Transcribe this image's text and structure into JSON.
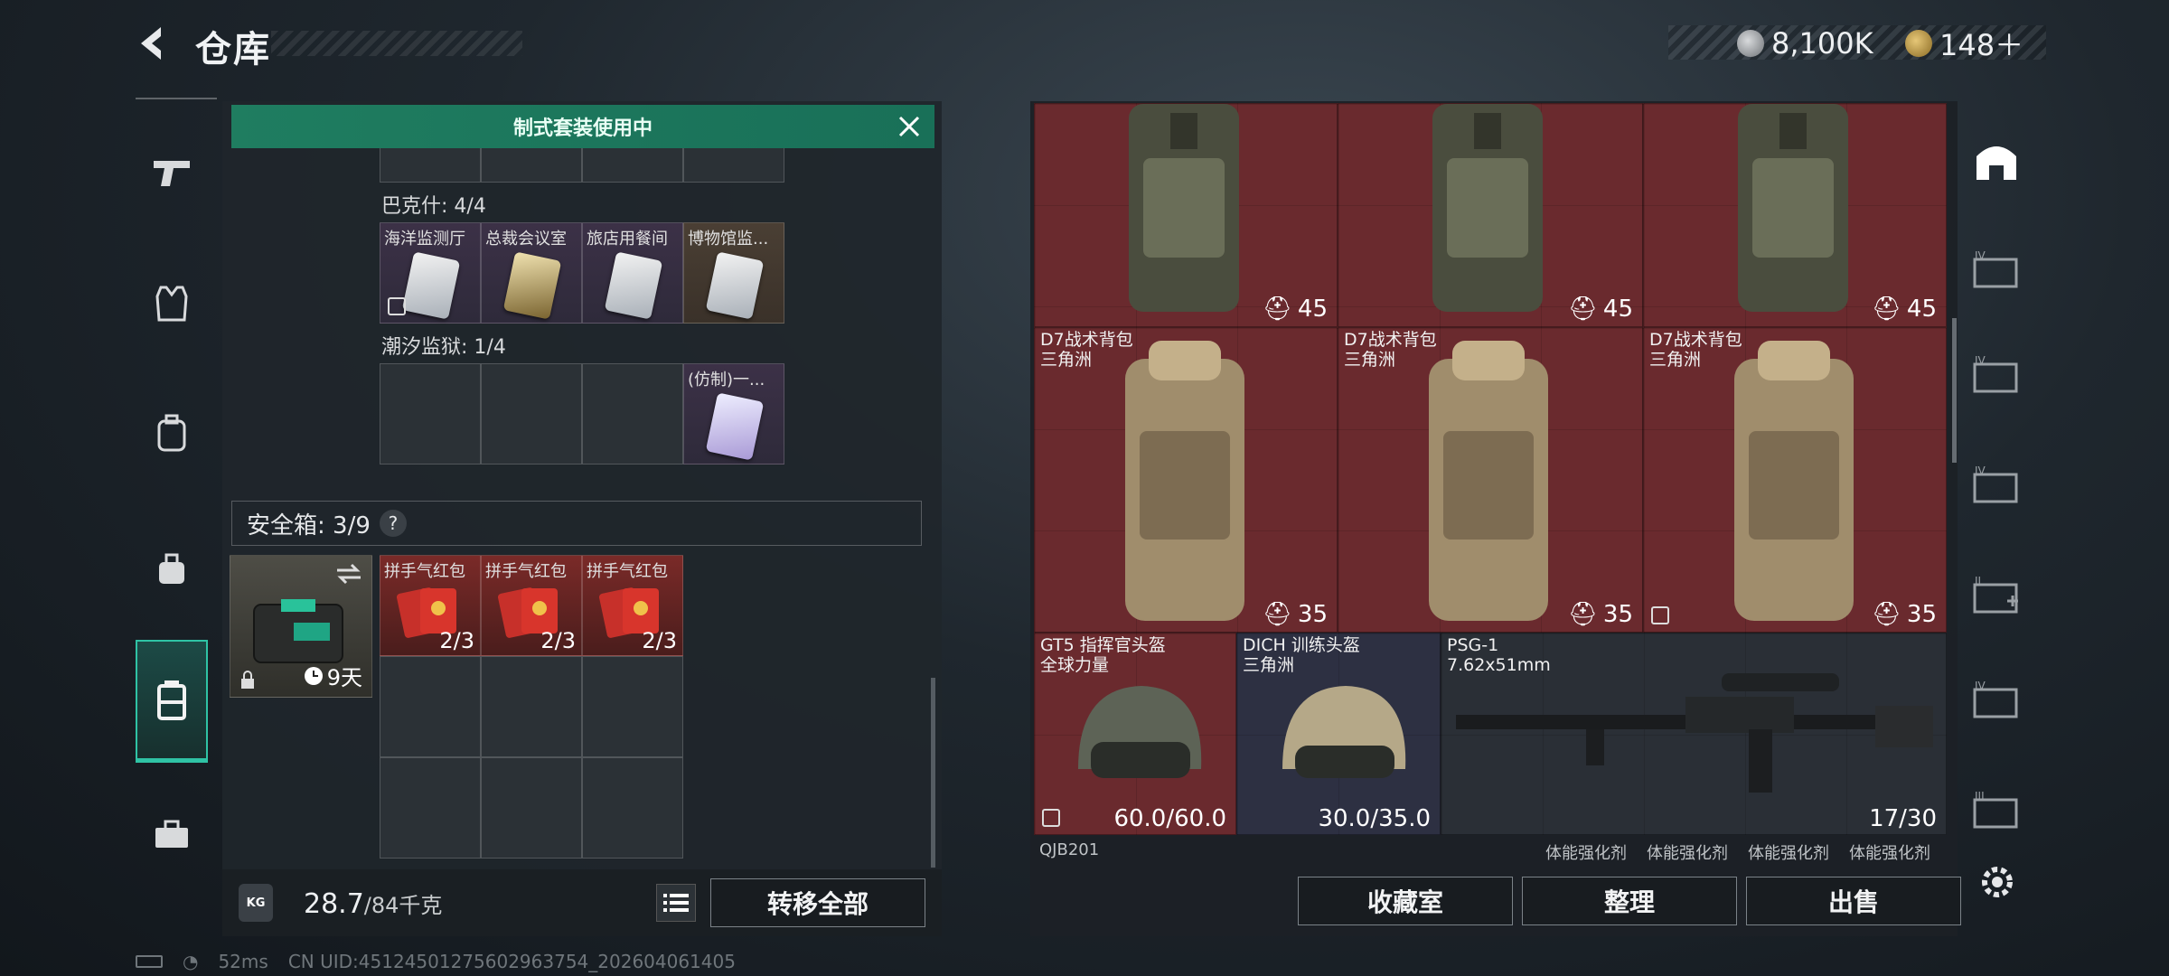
{
  "header": {
    "title": "仓库"
  },
  "currency": [
    {
      "name": "hafu-coin-icon",
      "value": "8,100K"
    },
    {
      "name": "triangle-coin-icon",
      "value": "148＋"
    }
  ],
  "banner": {
    "text": "制式套装使用中"
  },
  "cards": {
    "bakesh_label": "巴克什: 4/4",
    "bakesh_items": [
      "海洋监测厅",
      "总裁会议室",
      "旅店用餐间",
      "博物馆监..."
    ],
    "tide_label": "潮汐监狱: 1/4",
    "tide_items": [
      "(仿制)一..."
    ]
  },
  "safe": {
    "label": "安全箱: 3/9",
    "help": "?",
    "days": "9天",
    "items": [
      {
        "label": "拼手气红包",
        "count": "2/3"
      },
      {
        "label": "拼手气红包",
        "count": "2/3"
      },
      {
        "label": "拼手气红包",
        "count": "2/3"
      }
    ]
  },
  "weight": {
    "current": "28.7",
    "max": "/84千克",
    "icon_text": "KG"
  },
  "buttons": {
    "transfer_all": "转移全部",
    "collection": "收藏室",
    "organize": "整理",
    "sell": "出售"
  },
  "stash": {
    "row1_counts": [
      "45",
      "45",
      "45"
    ],
    "backpacks": [
      {
        "name": "D7战术背包",
        "maker": "三角洲",
        "count": "35"
      },
      {
        "name": "D7战术背包",
        "maker": "三角洲",
        "count": "35"
      },
      {
        "name": "D7战术背包",
        "maker": "三角洲",
        "count": "35"
      }
    ],
    "helmet1": {
      "name": "GT5 指挥官头盔",
      "maker": "全球力量",
      "durability": "60.0/60.0"
    },
    "helmet2": {
      "name": "DICH 训练头盔",
      "maker": "三角洲",
      "durability": "30.0/35.0"
    },
    "rifle": {
      "name": "PSG-1",
      "caliber": "7.62x51mm",
      "ammo": "17/30"
    },
    "partial": {
      "name": "QJB201",
      "stim_label": "体能强化剂"
    }
  },
  "status_bar": {
    "ping": "52ms",
    "uid": "CN UID:45124501275602963754_202604061405"
  },
  "colors": {
    "accent": "#2fc3a5",
    "banner": "#1f7d60",
    "backpack_bg": "#6a2a2e"
  }
}
